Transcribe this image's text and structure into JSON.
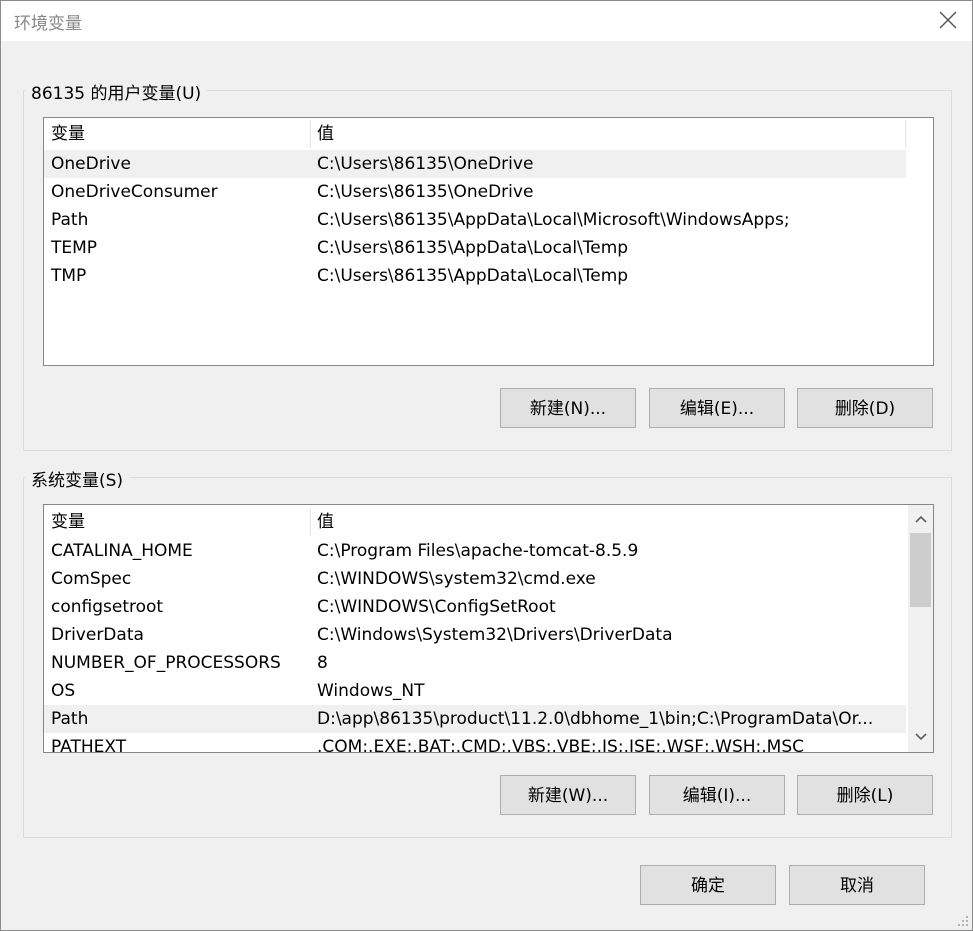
{
  "window": {
    "title": "环境变量"
  },
  "user_group": {
    "label": "86135 的用户变量(U)",
    "headers": {
      "name": "变量",
      "value": "值"
    },
    "rows": [
      {
        "name": "OneDrive",
        "value": "C:\\Users\\86135\\OneDrive"
      },
      {
        "name": "OneDriveConsumer",
        "value": "C:\\Users\\86135\\OneDrive"
      },
      {
        "name": "Path",
        "value": "C:\\Users\\86135\\AppData\\Local\\Microsoft\\WindowsApps;"
      },
      {
        "name": "TEMP",
        "value": "C:\\Users\\86135\\AppData\\Local\\Temp"
      },
      {
        "name": "TMP",
        "value": "C:\\Users\\86135\\AppData\\Local\\Temp"
      }
    ],
    "selected_row": "OneDrive",
    "buttons": {
      "new": "新建(N)...",
      "edit": "编辑(E)...",
      "delete": "删除(D)"
    }
  },
  "system_group": {
    "label": "系统变量(S)",
    "headers": {
      "name": "变量",
      "value": "值"
    },
    "rows": [
      {
        "name": "CATALINA_HOME",
        "value": "C:\\Program Files\\apache-tomcat-8.5.9"
      },
      {
        "name": "ComSpec",
        "value": "C:\\WINDOWS\\system32\\cmd.exe"
      },
      {
        "name": "configsetroot",
        "value": "C:\\WINDOWS\\ConfigSetRoot"
      },
      {
        "name": "DriverData",
        "value": "C:\\Windows\\System32\\Drivers\\DriverData"
      },
      {
        "name": "NUMBER_OF_PROCESSORS",
        "value": "8"
      },
      {
        "name": "OS",
        "value": "Windows_NT"
      },
      {
        "name": "Path",
        "value": "D:\\app\\86135\\product\\11.2.0\\dbhome_1\\bin;C:\\ProgramData\\Or..."
      },
      {
        "name": "PATHEXT",
        "value": ".COM;.EXE;.BAT;.CMD;.VBS;.VBE;.JS;.JSE;.WSF;.WSH;.MSC"
      }
    ],
    "selected_row": "Path",
    "buttons": {
      "new": "新建(W)...",
      "edit": "编辑(I)...",
      "delete": "删除(L)"
    }
  },
  "footer": {
    "ok": "确定",
    "cancel": "取消"
  },
  "icons": {
    "close": "close-icon",
    "scroll_up": "chevron-up-icon",
    "scroll_down": "chevron-down-icon"
  }
}
